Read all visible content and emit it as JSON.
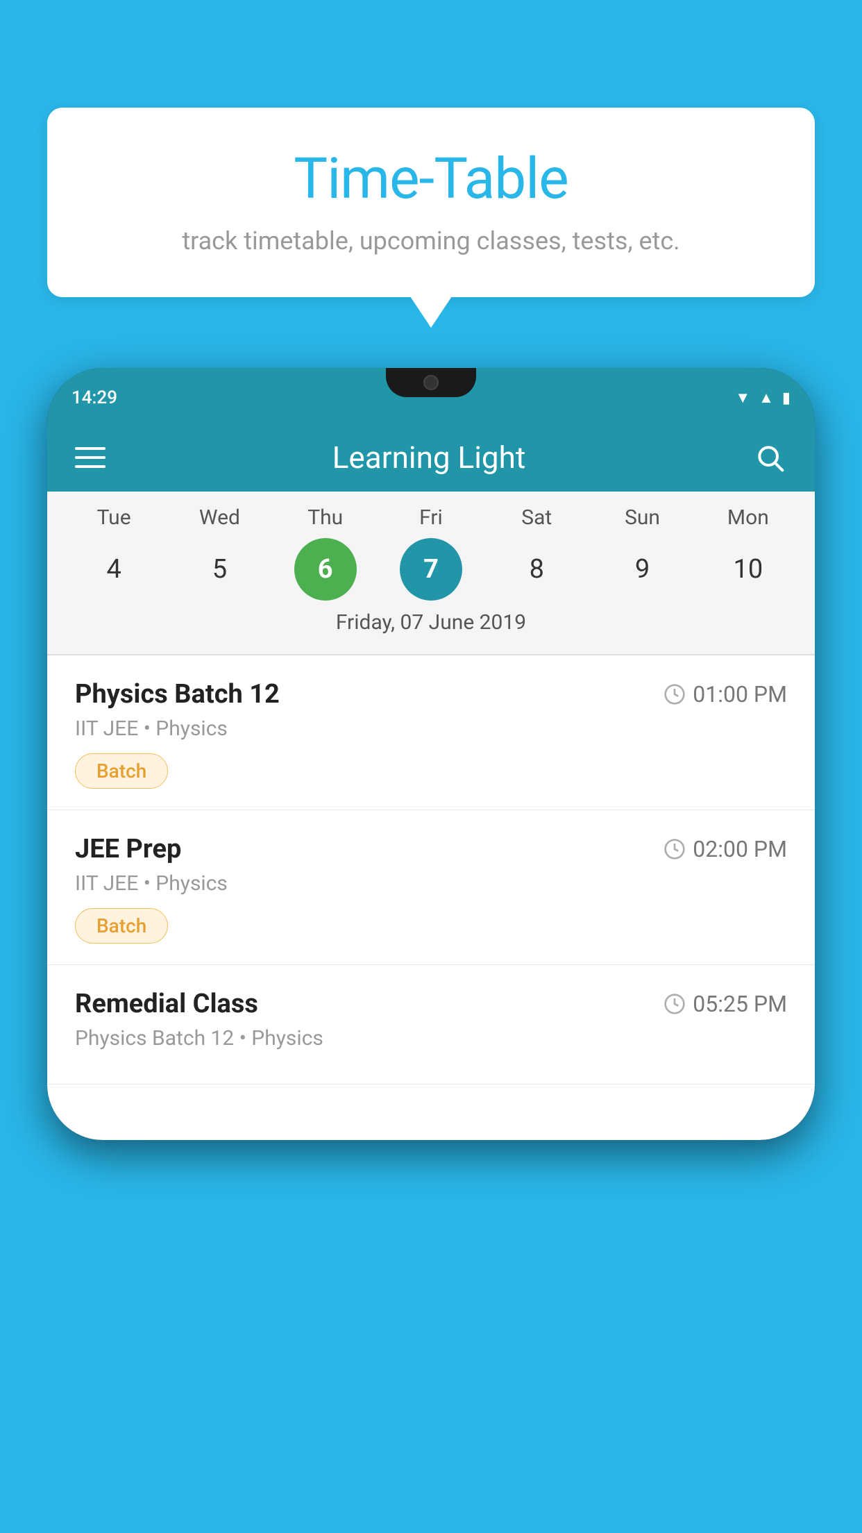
{
  "background_color": "#29b6e8",
  "bubble": {
    "title": "Time-Table",
    "subtitle": "track timetable, upcoming classes, tests, etc."
  },
  "phone": {
    "status_bar": {
      "time": "14:29"
    },
    "app_bar": {
      "title": "Learning Light"
    },
    "calendar": {
      "days": [
        {
          "label": "Tue",
          "number": "4"
        },
        {
          "label": "Wed",
          "number": "5"
        },
        {
          "label": "Thu",
          "number": "6",
          "state": "today"
        },
        {
          "label": "Fri",
          "number": "7",
          "state": "selected"
        },
        {
          "label": "Sat",
          "number": "8"
        },
        {
          "label": "Sun",
          "number": "9"
        },
        {
          "label": "Mon",
          "number": "10"
        }
      ],
      "selected_date_label": "Friday, 07 June 2019"
    },
    "schedule": [
      {
        "title": "Physics Batch 12",
        "time": "01:00 PM",
        "subtitle": "IIT JEE • Physics",
        "tag": "Batch"
      },
      {
        "title": "JEE Prep",
        "time": "02:00 PM",
        "subtitle": "IIT JEE • Physics",
        "tag": "Batch"
      },
      {
        "title": "Remedial Class",
        "time": "05:25 PM",
        "subtitle": "Physics Batch 12 • Physics",
        "tag": ""
      }
    ]
  }
}
